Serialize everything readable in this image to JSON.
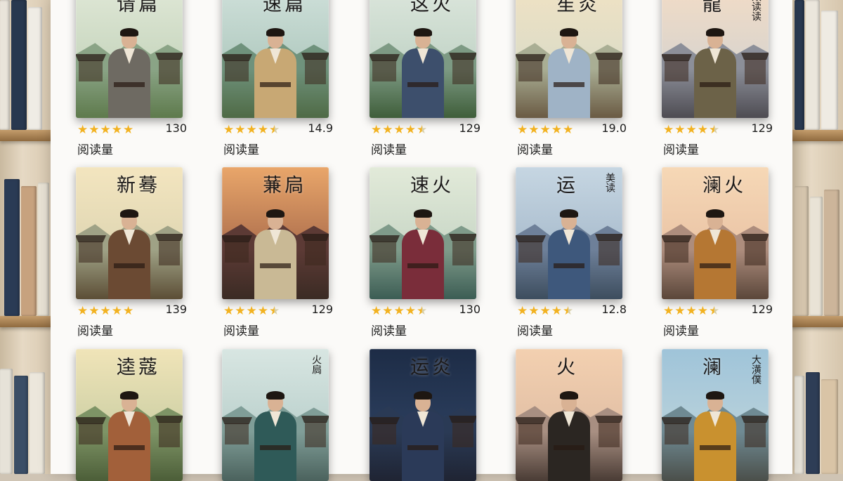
{
  "read_label": "阅读量",
  "rows": [
    [
      {
        "title": "请篇",
        "subtitle": "",
        "caption": "",
        "rating": 5,
        "reads": "130",
        "sky": [
          "#dfe7d6",
          "#b9ccb0"
        ],
        "mtn": "#8aa486",
        "ground": "#5e7a4c",
        "robe": "#6e6a62"
      },
      {
        "title": "速篇",
        "subtitle": "",
        "caption": "",
        "rating": 4.5,
        "reads": "14.9",
        "sky": [
          "#cfe0da",
          "#9fbdb0"
        ],
        "mtn": "#6f927c",
        "ground": "#4f6a45",
        "robe": "#c8a874"
      },
      {
        "title": "这火",
        "subtitle": "",
        "caption": "",
        "rating": 4.5,
        "reads": "129",
        "sky": [
          "#dce6dc",
          "#b2c9ba"
        ],
        "mtn": "#7d9a84",
        "ground": "#3f5e3a",
        "robe": "#3d4f6c"
      },
      {
        "title": "笙炎",
        "subtitle": "",
        "caption": "",
        "rating": 5,
        "reads": "19.0",
        "sky": [
          "#f0e2c4",
          "#cfd8c8"
        ],
        "mtn": "#a9ae94",
        "ground": "#6a5a43",
        "robe": "#9fb3c6"
      },
      {
        "title": "龍",
        "subtitle": "效读读",
        "caption": "",
        "rating": 4.5,
        "reads": "129",
        "sky": [
          "#f2dcc6",
          "#c9cfd2"
        ],
        "mtn": "#8c8f99",
        "ground": "#4e4c52",
        "robe": "#6c6248"
      }
    ],
    [
      {
        "title": "新蓦",
        "subtitle": "",
        "caption": "",
        "rating": 5,
        "reads": "139",
        "sky": [
          "#f3e5bf",
          "#d3cdab"
        ],
        "mtn": "#9fa286",
        "ground": "#5c4e36",
        "robe": "#6b4a33"
      },
      {
        "title": "蒹扃",
        "subtitle": "",
        "caption": "",
        "rating": 4.5,
        "reads": "129",
        "sky": [
          "#e9a66a",
          "#8a4e3c"
        ],
        "mtn": "#5c3a35",
        "ground": "#3b2b24",
        "robe": "#c9b995"
      },
      {
        "title": "速火",
        "subtitle": "",
        "caption": "",
        "rating": 4.5,
        "reads": "130",
        "sky": [
          "#e2ead9",
          "#b9cbbb"
        ],
        "mtn": "#7f9b8a",
        "ground": "#3c5d54",
        "robe": "#7a2d3a"
      },
      {
        "title": "运",
        "subtitle": "美读",
        "caption": "",
        "rating": 4.5,
        "reads": "12.8",
        "sky": [
          "#c6d6e2",
          "#98adc1"
        ],
        "mtn": "#6e8099",
        "ground": "#3d4d5e",
        "robe": "#3e587c"
      },
      {
        "title": "澜火",
        "subtitle": "",
        "caption": "",
        "rating": 4.5,
        "reads": "129",
        "sky": [
          "#f6d8b6",
          "#e3b89c"
        ],
        "mtn": "#ad8d7d",
        "ground": "#5b473a",
        "robe": "#b57733"
      }
    ],
    [
      {
        "title": "逵蔻",
        "subtitle": "",
        "caption": "",
        "rating": 0,
        "reads": "",
        "sky": [
          "#f0e4b8",
          "#b9c49a"
        ],
        "mtn": "#7e9466",
        "ground": "#4c5e38",
        "robe": "#a2603a"
      },
      {
        "title": "",
        "subtitle": "火扃",
        "caption": "",
        "rating": 0,
        "reads": "",
        "sky": [
          "#d8e6e2",
          "#aac4c0"
        ],
        "mtn": "#809e98",
        "ground": "#4b625d",
        "robe": "#2f5a58"
      },
      {
        "title": "运炎",
        "subtitle": "",
        "caption": "",
        "rating": 0,
        "reads": "",
        "sky": [
          "#1d2c46",
          "#34496b"
        ],
        "mtn": "#2a3a55",
        "ground": "#1f2433",
        "robe": "#2b3a58"
      },
      {
        "title": "火",
        "subtitle": "",
        "caption": "",
        "rating": 0,
        "reads": "",
        "sky": [
          "#f3d0b0",
          "#d7b59e"
        ],
        "mtn": "#a88f82",
        "ground": "#4a3c35",
        "robe": "#2b2622"
      },
      {
        "title": "澜",
        "subtitle": "大潢僕",
        "caption": "",
        "rating": 0,
        "reads": "",
        "sky": [
          "#9fc4d9",
          "#c7d9dc"
        ],
        "mtn": "#6f8a93",
        "ground": "#4b4f4a",
        "robe": "#c9912f"
      }
    ]
  ]
}
